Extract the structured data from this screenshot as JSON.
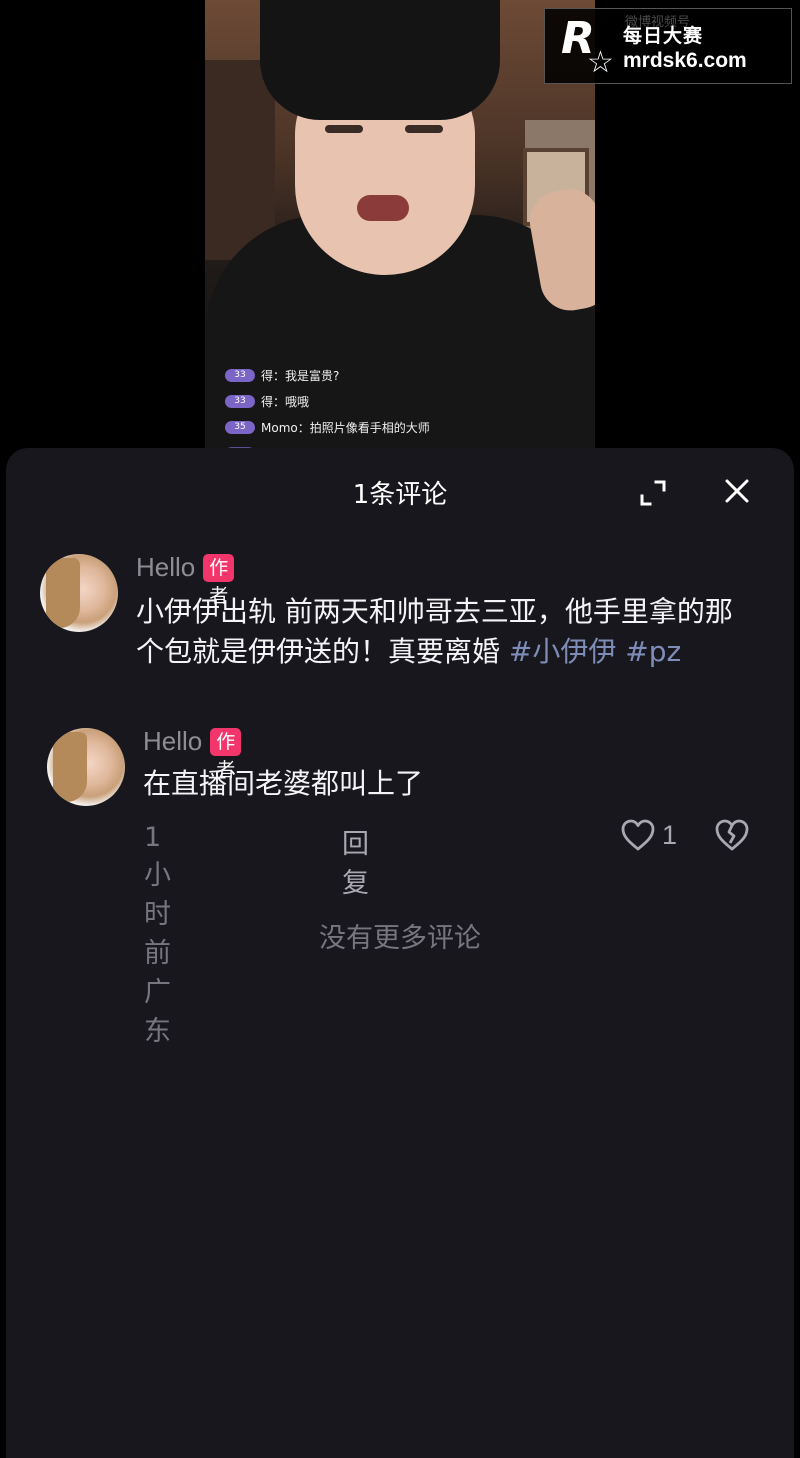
{
  "video": {
    "live_comments": [
      {
        "level": "33",
        "text": "得：我是富贵?"
      },
      {
        "level": "33",
        "text": "得：哦哦"
      },
      {
        "level": "35",
        "text": "Momo：拍照片像看手相的大师"
      },
      {
        "level": "",
        "text": "……"
      }
    ]
  },
  "watermark": {
    "cn_text": "每日大赛",
    "url": "mrdsk6.com",
    "ghost_text": "微博视频号"
  },
  "comment_panel": {
    "title": "1条评论",
    "comments": [
      {
        "author": "Hello",
        "badge": "作者",
        "text_main": "小伊伊出轨 前两天和帅哥去三亚，他手里拿的那个包就是伊伊送的！真要离婚",
        "hashtags": "#小伊伊 #pz"
      },
      {
        "author": "Hello",
        "badge": "作者",
        "text": "在直播间老婆都叫上了",
        "meta": "1小时前 广东",
        "reply_label": "回复",
        "like_count": "1"
      }
    ],
    "no_more": "没有更多评论"
  },
  "colors": {
    "sheet_bg": "#18171d",
    "badge": "#f2366b",
    "hashtag": "#7d8db8"
  }
}
